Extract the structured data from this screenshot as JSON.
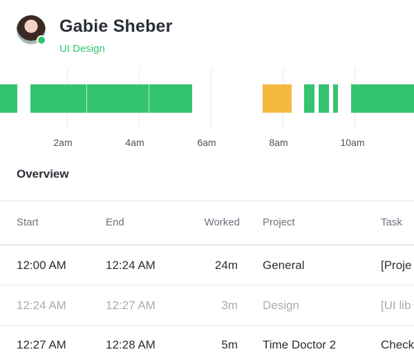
{
  "user": {
    "name": "Gabie Sheber",
    "role": "UI Design"
  },
  "timeline": {
    "ticks": [
      "2am",
      "4am",
      "6am",
      "8am",
      "10am"
    ]
  },
  "overview": {
    "title": "Overview",
    "columns": [
      "Start",
      "End",
      "Worked",
      "Project",
      "Task"
    ],
    "rows": [
      {
        "start": "12:00 AM",
        "end": "12:24 AM",
        "worked": "24m",
        "project": "General",
        "task": "[Proje"
      },
      {
        "start": "12:24 AM",
        "end": "12:27 AM",
        "worked": "3m",
        "project": "Design",
        "task": "[UI lib"
      },
      {
        "start": "12:27 AM",
        "end": "12:28 AM",
        "worked": "5m",
        "project": "Time Doctor 2",
        "task": "Check"
      }
    ]
  },
  "colors": {
    "accent_green": "#34c36f",
    "accent_orange": "#f6b940",
    "text_primary": "#2a2e35",
    "text_muted": "#a7abb2"
  }
}
